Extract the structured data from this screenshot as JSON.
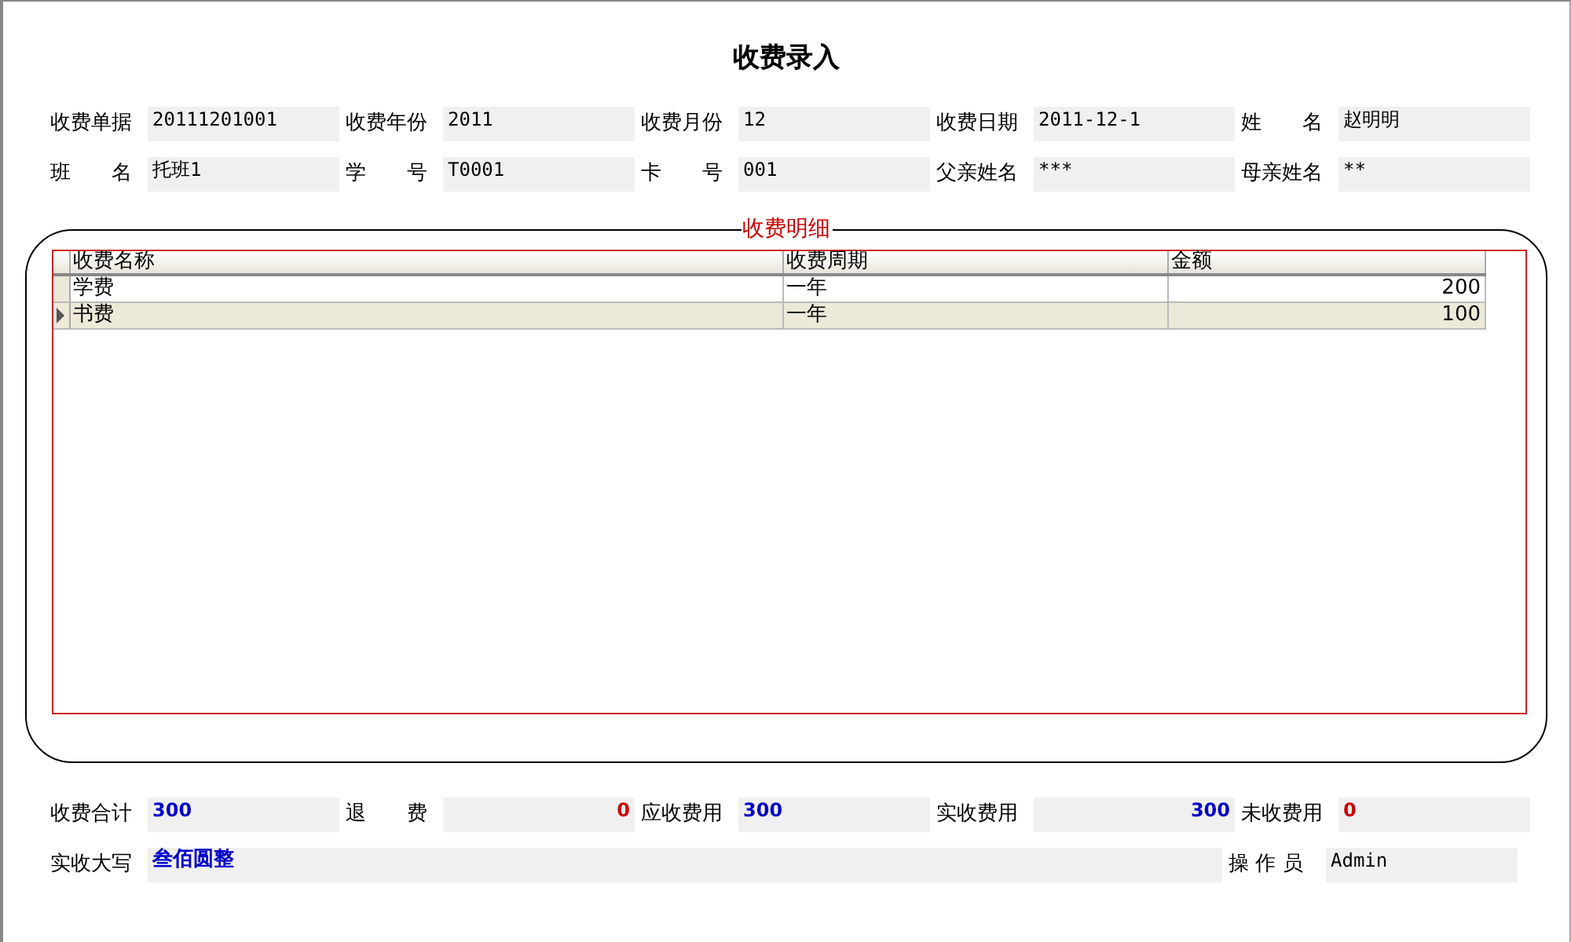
{
  "window": {
    "title": "收费录入"
  },
  "header_rows": [
    [
      {
        "label": "收费单据",
        "value": "20111201001"
      },
      {
        "label": "收费年份",
        "value": "2011"
      },
      {
        "label": "收费月份",
        "value": "12"
      },
      {
        "label": "收费日期",
        "value": "2011-12-1"
      },
      {
        "label": "姓　　名",
        "value": "赵明明"
      }
    ],
    [
      {
        "label": "班　　名",
        "value": "托班1"
      },
      {
        "label": "学　　号",
        "value": "T0001"
      },
      {
        "label": "卡　　号",
        "value": "001"
      },
      {
        "label": "父亲姓名",
        "value": "***"
      },
      {
        "label": "母亲姓名",
        "value": "**"
      }
    ]
  ],
  "detail": {
    "legend": "收费明细",
    "columns": [
      "收费名称",
      "收费周期",
      "金额"
    ],
    "rows": [
      {
        "cells": [
          "学费",
          "一年",
          "200"
        ],
        "selected": false
      },
      {
        "cells": [
          "书费",
          "一年",
          "100"
        ],
        "selected": true
      }
    ]
  },
  "totals": [
    {
      "label": "收费合计",
      "value": "300",
      "color": "#0000cc",
      "kind": "leading"
    },
    {
      "label": "退　　费",
      "value": "0",
      "color": "#cc0000",
      "kind": "trailing"
    },
    {
      "label": "应收费用",
      "value": "300",
      "color": "#0000cc",
      "kind": "leading"
    },
    {
      "label": "实收费用",
      "value": "300",
      "color": "#0000cc",
      "kind": "trailing"
    },
    {
      "label": "未收费用",
      "value": "0",
      "color": "#cc0000",
      "kind": "leading"
    }
  ],
  "amount_in_words": {
    "label": "实收大写",
    "value": "叁佰圆整",
    "color": "#0000cc"
  },
  "operator": {
    "label": "操 作 员",
    "value": "Admin"
  }
}
